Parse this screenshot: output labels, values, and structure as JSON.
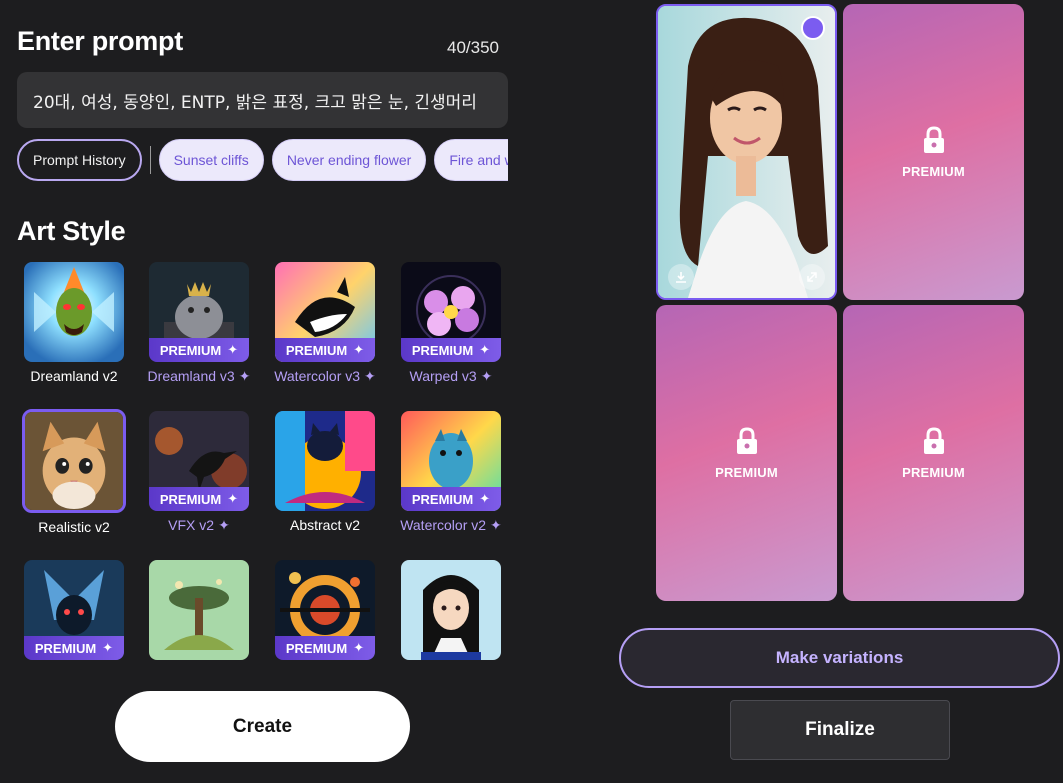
{
  "prompt": {
    "title": "Enter prompt",
    "char_count": "40/350",
    "value": "20대, 여성, 동양인, ENTP, 밝은 표정, 크고 맑은 눈, 긴생머리"
  },
  "chips": {
    "history": "Prompt History",
    "suggestions": [
      "Sunset cliffs",
      "Never ending flower",
      "Fire and w"
    ]
  },
  "art_style": {
    "title": "Art Style",
    "premium_label": "PREMIUM",
    "spark": "✦",
    "tiles": [
      {
        "label": "Dreamland v2",
        "premium": false
      },
      {
        "label": "Dreamland v3",
        "premium": true
      },
      {
        "label": "Watercolor v3",
        "premium": true
      },
      {
        "label": "Warped v3",
        "premium": true
      },
      {
        "label": "Realistic v2",
        "premium": false,
        "selected": true
      },
      {
        "label": "VFX v2",
        "premium": true
      },
      {
        "label": "Abstract v2",
        "premium": false
      },
      {
        "label": "Watercolor v2",
        "premium": true
      },
      {
        "label": "",
        "premium": true
      },
      {
        "label": "",
        "premium": false
      },
      {
        "label": "",
        "premium": true
      },
      {
        "label": "",
        "premium": false
      }
    ]
  },
  "actions": {
    "create": "Create",
    "make_variations": "Make variations",
    "finalize": "Finalize"
  },
  "results": {
    "locked_label": "PREMIUM"
  },
  "colors": {
    "accent": "#7b5cf0",
    "background": "#1d1d1f",
    "premium_gradient_start": "#5b38c9"
  }
}
